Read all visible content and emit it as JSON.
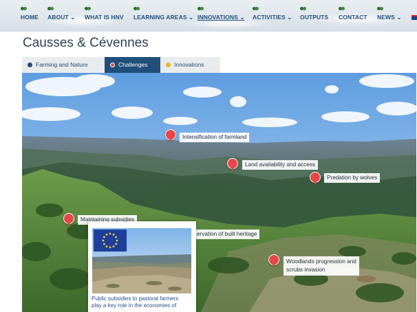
{
  "nav": {
    "items": [
      {
        "label": "HOME"
      },
      {
        "label": "ABOUT ⌄"
      },
      {
        "label": "WHAT IS HNV"
      },
      {
        "label": "LEARNING AREAS ⌄"
      },
      {
        "label": "INNOVATIONS ⌄"
      },
      {
        "label": "ACTIVITIES ⌄"
      },
      {
        "label": "OUTPUTS"
      },
      {
        "label": "CONTACT"
      },
      {
        "label": "NEWS ⌄"
      }
    ],
    "active_item": "INNOVATIONS ⌄"
  },
  "page": {
    "title": "Causses & Cévennes"
  },
  "tabs": [
    {
      "label": "Farming and Nature",
      "dot_color": "#1f4f7a"
    },
    {
      "label": "Challenges",
      "dot_color": "#e64848",
      "active": true
    },
    {
      "label": "Innovations",
      "dot_color": "#f2b824"
    }
  ],
  "markers": [
    {
      "label": "Intensification of farmland"
    },
    {
      "label": "Land availability and access"
    },
    {
      "label": "Predation by wolves"
    },
    {
      "label": "Maintaining subsidies"
    },
    {
      "label": "ervation of built heritage"
    },
    {
      "label_line1": "Woodlands progression and",
      "label_line2": "scrubs invasion"
    }
  ],
  "popup": {
    "caption_line1": "Public subsidies to pastoral farmers",
    "caption_line2": "play a key role in the economies of"
  },
  "colors": {
    "brand": "#1f4f7a",
    "marker": "#e64848",
    "accent": "#f2b824"
  }
}
